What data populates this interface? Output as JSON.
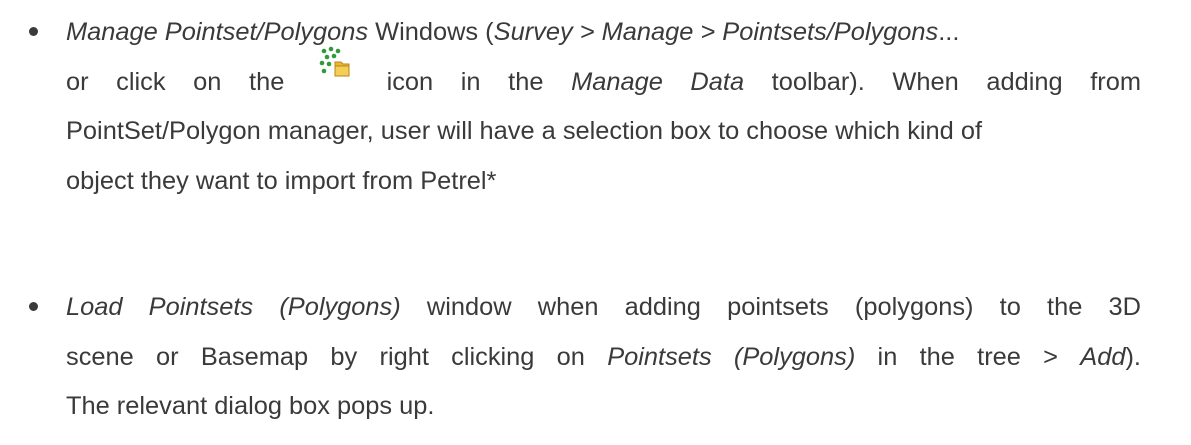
{
  "bullets": [
    {
      "l1": {
        "a": "Manage Pointset/Polygons",
        "b": " Windows (",
        "c": "Survey > Manage > Pointsets/Polygons",
        "d": "..."
      },
      "l2": {
        "a": "or click on the",
        "icon": "pointset-manager-icon",
        "b": "icon in the ",
        "c": "Manage Data",
        "d": " toolbar). When adding from"
      },
      "l3": "PointSet/Polygon manager, user will have a selection box to choose which kind of",
      "l4": "object they want to import from Petrel*"
    },
    {
      "l1": {
        "a": "Load Pointsets (Polygons)",
        "b": " window when adding pointsets (polygons) to the 3D"
      },
      "l2": {
        "a": "scene or Basemap by right clicking on ",
        "b": "Pointsets (Polygons)",
        "c": " in the tree > ",
        "d": "Add",
        "e": ")."
      },
      "l3": "The relevant dialog box pops up."
    }
  ],
  "colors": {
    "text": "#3a3a3a",
    "icon_dots": "#2e9a3a",
    "icon_folder": "#e8b830"
  }
}
